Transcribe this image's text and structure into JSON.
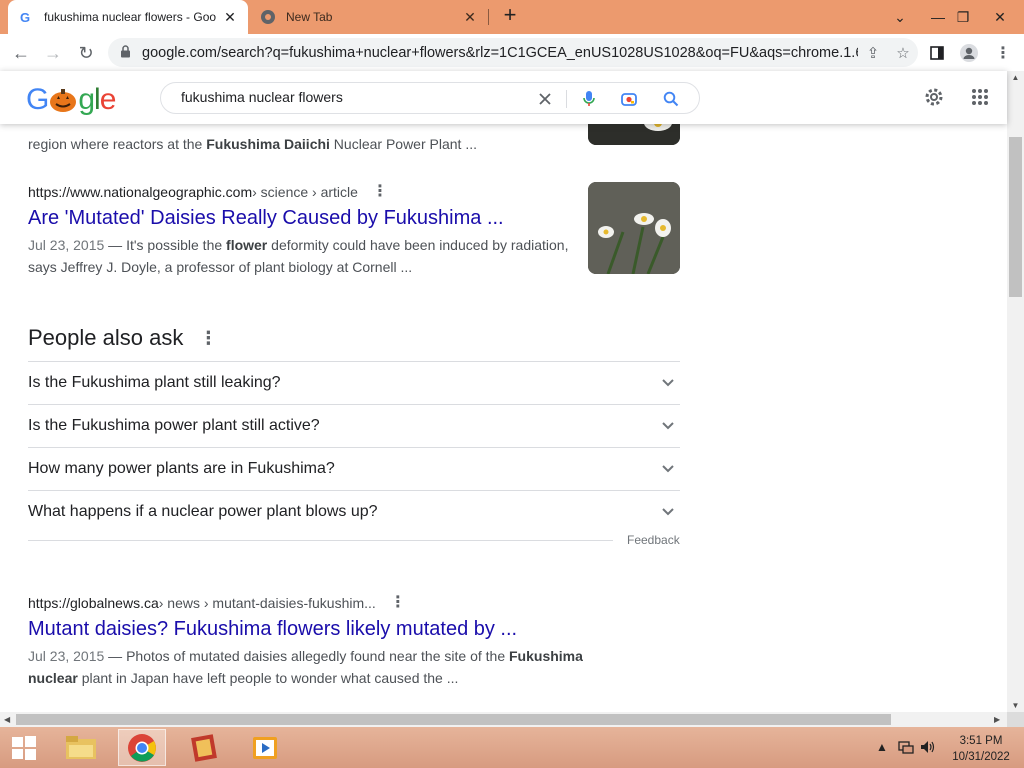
{
  "browser": {
    "tabs": [
      {
        "title": "fukushima nuclear flowers - Goo",
        "active": true
      },
      {
        "title": "New Tab",
        "active": false
      }
    ],
    "new_tab_label": "+",
    "url": "google.com/search?q=fukushima+nuclear+flowers&rlz=1C1GCEA_enUS1028US1028&oq=FU&aqs=chrome.1.69..."
  },
  "google": {
    "logo": {
      "text_g": "G",
      "text_gle": "gle"
    },
    "query": "fukushima nuclear flowers"
  },
  "results": [
    {
      "snippet_partial_pre": "region where reactors at the ",
      "snippet_partial_bold": "Fukushima Daiichi",
      "snippet_partial_post": " Nuclear Power Plant ..."
    },
    {
      "site": "https://www.nationalgeographic.com",
      "path": " › science › article",
      "title": "Are 'Mutated' Daisies Really Caused by Fukushima ...",
      "date": "Jul 23, 2015",
      "snippet_pre": " — It's possible the ",
      "snippet_bold": "flower",
      "snippet_post": " deformity could have been induced by radiation, says Jeffrey J. Doyle, a professor of plant biology at Cornell ..."
    },
    {
      "site": "https://globalnews.ca",
      "path": " › news › mutant-daisies-fukushim...",
      "title": "Mutant daisies? Fukushima flowers likely mutated by ...",
      "date": "Jul 23, 2015",
      "snippet_pre": " — Photos of mutated daisies allegedly found near the site of the ",
      "snippet_bold": "Fukushima nuclear",
      "snippet_post": " plant in Japan have left people to wonder what caused the ..."
    }
  ],
  "people_also_ask": {
    "title": "People also ask",
    "questions": [
      "Is the Fukushima plant still leaking?",
      "Is the Fukushima power plant still active?",
      "How many power plants are in Fukushima?",
      "What happens if a nuclear power plant blows up?"
    ],
    "feedback": "Feedback"
  },
  "taskbar": {
    "time": "3:51 PM",
    "date": "10/31/2022"
  },
  "colors": {
    "tabbar": "#ec9a6e",
    "link": "#1a0dab",
    "taskbar": "#d79b80"
  }
}
